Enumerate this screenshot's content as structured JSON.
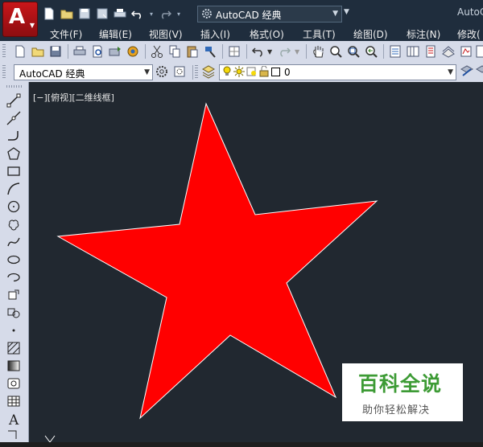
{
  "titlebar": {
    "workspace_name": "AutoCAD 经典",
    "title_partial": "AutoC"
  },
  "menu": {
    "items": [
      {
        "label": "文件(F)"
      },
      {
        "label": "编辑(E)"
      },
      {
        "label": "视图(V)"
      },
      {
        "label": "插入(I)"
      },
      {
        "label": "格式(O)"
      },
      {
        "label": "工具(T)"
      },
      {
        "label": "绘图(D)"
      },
      {
        "label": "标注(N)"
      },
      {
        "label": "修改("
      }
    ]
  },
  "workspace_toolbar": {
    "workspace_value": "AutoCAD 经典",
    "layer_value": "0"
  },
  "canvas": {
    "viewport_label": "[−][俯视][二维线框]",
    "background": "#212830",
    "shape": {
      "type": "star",
      "points": 5,
      "fill": "#ff0000",
      "stroke": "#ffffff"
    }
  },
  "watermark": {
    "title": "百科全说",
    "subtitle": "助你轻松解决",
    "color": "#3d9b35"
  },
  "colors": {
    "titlebar": "#1f2d3d",
    "toolbar": "#d6dbe9",
    "app_button": "#c8161a"
  }
}
